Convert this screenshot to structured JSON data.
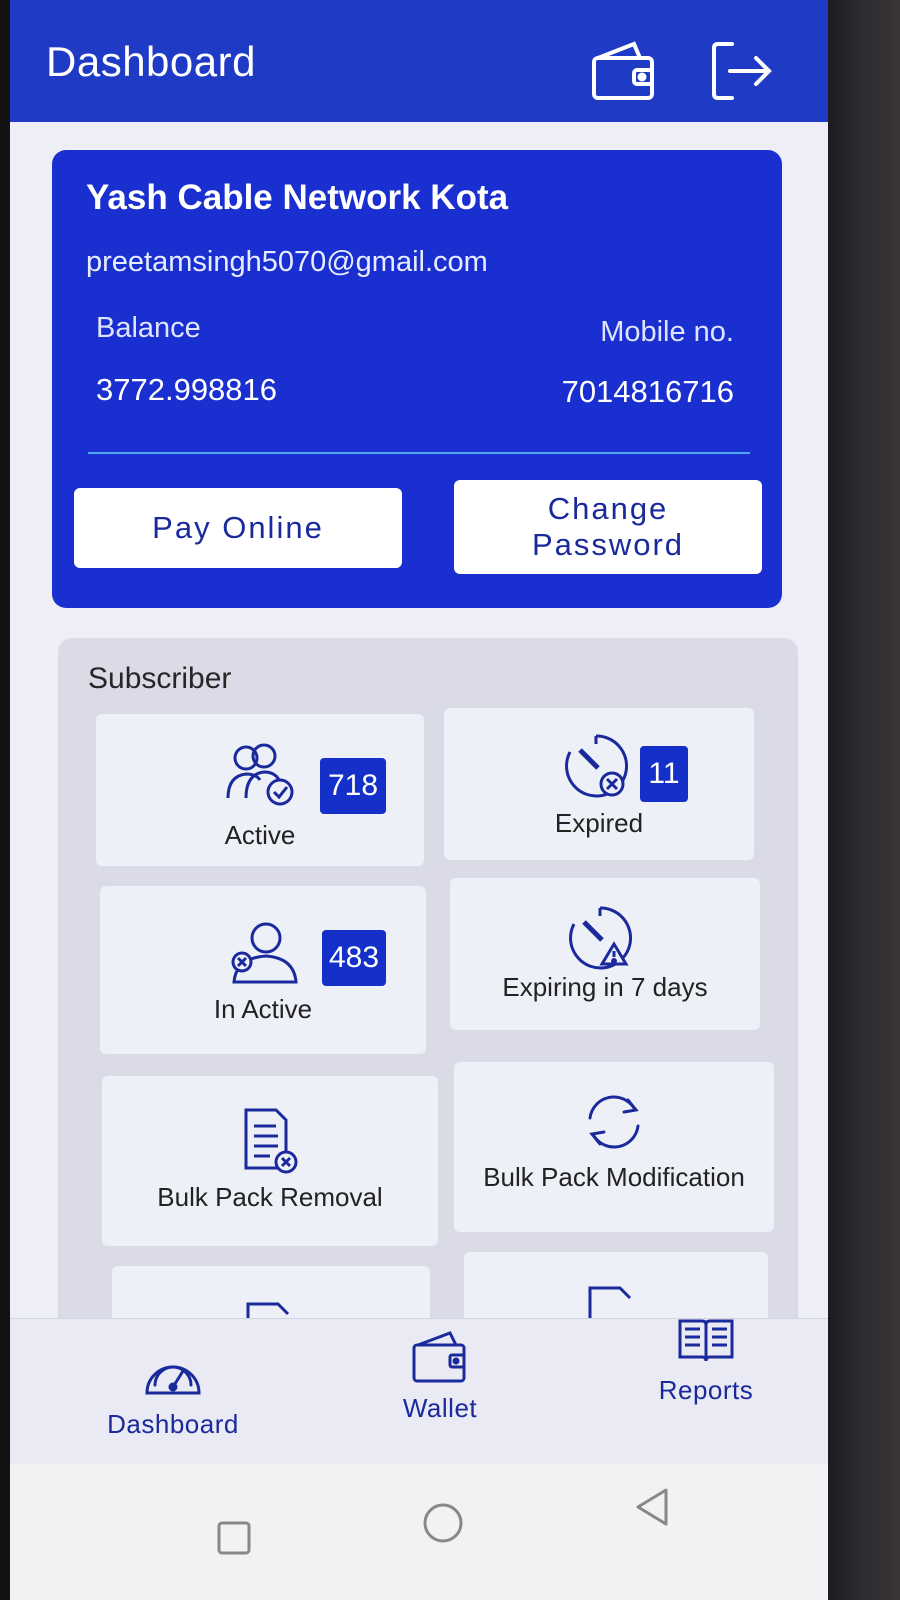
{
  "appbar": {
    "title": "Dashboard",
    "wallet_icon": "wallet-icon",
    "logout_icon": "logout-icon"
  },
  "profile": {
    "company": "Yash Cable Network Kota",
    "email": "preetamsingh5070@gmail.com",
    "balance_label": "Balance",
    "balance_value": "3772.998816",
    "mobile_label": "Mobile no.",
    "mobile_value": "7014816716",
    "pay_online": "Pay Online",
    "change_password": "Change Password"
  },
  "subscriber": {
    "title": "Subscriber",
    "tiles": [
      {
        "label": "Active",
        "count": "718",
        "icon": "users-check-icon"
      },
      {
        "label": "Expired",
        "count": "11",
        "icon": "clock-expired-icon"
      },
      {
        "label": "In Active",
        "count": "483",
        "icon": "user-inactive-icon"
      },
      {
        "label": "Expiring in 7 days",
        "icon": "clock-warning-icon"
      },
      {
        "label": "Bulk Pack Removal",
        "icon": "document-remove-icon"
      },
      {
        "label": "Bulk Pack Modification",
        "icon": "refresh-icon"
      }
    ]
  },
  "nav": {
    "items": [
      {
        "label": "Dashboard",
        "icon": "speedometer-icon"
      },
      {
        "label": "Wallet",
        "icon": "wallet-icon"
      },
      {
        "label": "Reports",
        "icon": "book-icon"
      }
    ]
  },
  "colors": {
    "primary": "#1f3bc6",
    "card": "#1a2fd0",
    "badge": "#1530c9",
    "icon": "#1a2a9c"
  }
}
